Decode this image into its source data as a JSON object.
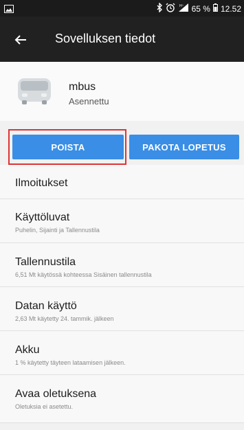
{
  "status_bar": {
    "battery": "65 %",
    "time": "12.52",
    "icons": [
      "bluetooth-icon",
      "alarm-icon",
      "signal-icon",
      "battery-icon"
    ]
  },
  "app_bar": {
    "back_icon": "back-arrow-icon",
    "title": "Sovelluksen tiedot"
  },
  "app": {
    "name": "mbus",
    "status": "Asennettu",
    "icon": "app-bus-icon"
  },
  "buttons": {
    "uninstall": "POISTA",
    "force_stop": "PAKOTA LOPETUS"
  },
  "settings": [
    {
      "title": "Ilmoitukset",
      "subtitle": ""
    },
    {
      "title": "Käyttöluvat",
      "subtitle": "Puhelin, Sijainti ja Tallennustila"
    },
    {
      "title": "Tallennustila",
      "subtitle": "6,51 Mt käytössä kohteessa Sisäinen tallennustila"
    },
    {
      "title": "Datan käyttö",
      "subtitle": "2,63 Mt käytetty 24. tammik. jälkeen"
    },
    {
      "title": "Akku",
      "subtitle": "1 % käytetty täyteen lataamisen jälkeen."
    },
    {
      "title": "Avaa oletuksena",
      "subtitle": "Oletuksia ei asetettu."
    }
  ],
  "colors": {
    "accent": "#3a8ee6",
    "appbar": "#212121",
    "highlight": "#d33333"
  }
}
